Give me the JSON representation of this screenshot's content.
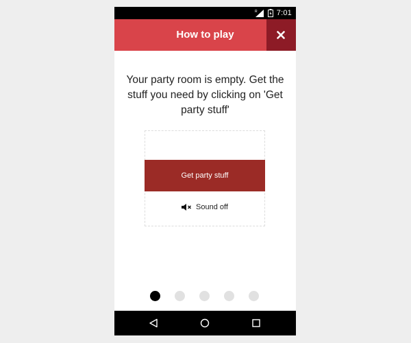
{
  "status_bar": {
    "time": "7:01",
    "icons": [
      "signal-icon",
      "battery-icon"
    ]
  },
  "header": {
    "title": "How to play",
    "close_icon": "close-icon",
    "background": "#d9444a",
    "close_background": "#8d1b26"
  },
  "main": {
    "message": "Your party room is empty. Get the stuff you need by clicking on 'Get party stuff'",
    "party_button_label": "Get party stuff",
    "party_button_color": "#9b2b26",
    "sound_label": "Sound off",
    "sound_icon": "speaker-muted-icon"
  },
  "pagination": {
    "total": 5,
    "current": 1
  },
  "nav_bar": {
    "buttons": [
      "back-icon",
      "home-icon",
      "recents-icon"
    ]
  }
}
